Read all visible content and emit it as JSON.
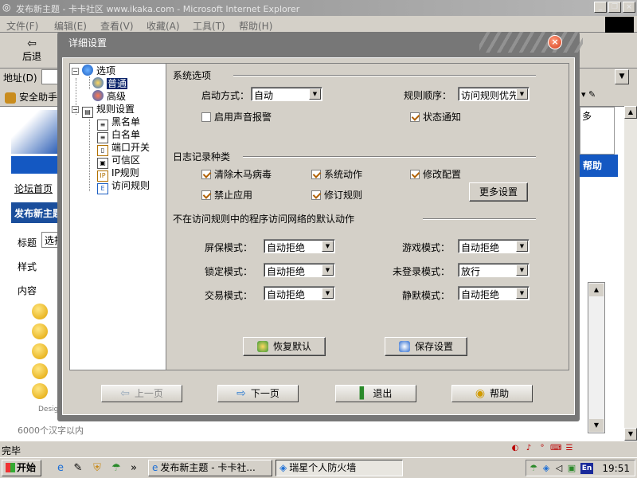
{
  "ie": {
    "title": "发布新主题 - 卡卡社区 www.ikaka.com - Microsoft Internet Explorer",
    "menu": [
      "文件(F)",
      "编辑(E)",
      "查看(V)",
      "收藏(A)",
      "工具(T)",
      "帮助(H)"
    ],
    "back_label": "后退",
    "address_label": "地址(D)",
    "links_helper": "安全助手",
    "page": {
      "forum_home": "论坛首页",
      "new_topic": "发布新主题",
      "title_label": "标题",
      "title_value": "选择",
      "style_label": "样式",
      "content_label": "内容",
      "design_text": "Design",
      "limit_text": "6000个汉字以内",
      "help_text": "帮助",
      "right_text": "多"
    },
    "status": "完毕"
  },
  "taskbar": {
    "start": "开始",
    "tasks": [
      "发布新主题 - 卡卡社...",
      "瑞星个人防火墙"
    ],
    "clock": "19:51",
    "lang": "En"
  },
  "dialog": {
    "title": "详细设置",
    "tree": {
      "options": "选项",
      "normal": "普通",
      "advanced": "高级",
      "rules": "规则设置",
      "blacklist": "黑名单",
      "whitelist": "白名单",
      "port_switch": "端口开关",
      "trusted_zone": "可信区",
      "ip_rules": "IP规则",
      "access_rules": "访问规则"
    },
    "system_options": {
      "title": "系统选项",
      "startup_label": "启动方式：",
      "startup_value": "自动",
      "rule_order_label": "规则顺序：",
      "rule_order_value": "访问规则优先",
      "sound_alarm": "启用声音报警",
      "sound_alarm_checked": false,
      "status_notify": "状态通知",
      "status_notify_checked": true
    },
    "log_types": {
      "title": "日志记录种类",
      "items": [
        {
          "label": "清除木马病毒",
          "checked": true
        },
        {
          "label": "系统动作",
          "checked": true
        },
        {
          "label": "修改配置",
          "checked": true
        },
        {
          "label": "禁止应用",
          "checked": true
        },
        {
          "label": "修订规则",
          "checked": true
        }
      ],
      "more_button": "更多设置"
    },
    "default_action": {
      "title": "不在访问规则中的程序访问网络的默认动作",
      "screensaver_label": "屏保模式：",
      "screensaver_value": "自动拒绝",
      "game_label": "游戏模式：",
      "game_value": "自动拒绝",
      "lock_label": "锁定模式：",
      "lock_value": "自动拒绝",
      "notlogged_label": "未登录模式：",
      "notlogged_value": "放行",
      "trade_label": "交易模式：",
      "trade_value": "自动拒绝",
      "silent_label": "静默模式：",
      "silent_value": "自动拒绝"
    },
    "restore_button": "恢复默认",
    "save_button": "保存设置",
    "nav": {
      "prev": "上一页",
      "next": "下一页",
      "exit": "退出",
      "help": "帮助"
    }
  }
}
